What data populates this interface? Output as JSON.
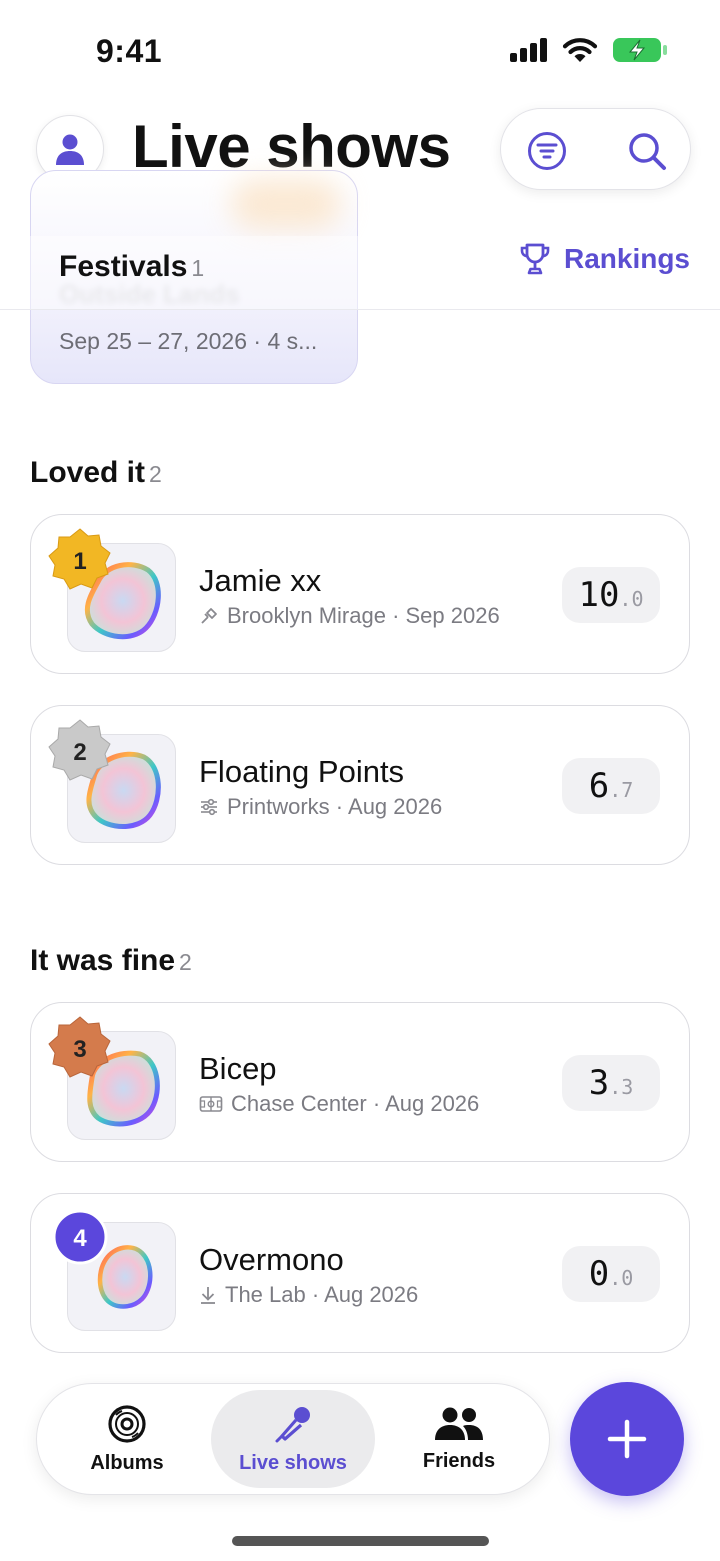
{
  "status_bar": {
    "time": "9:41"
  },
  "header": {
    "title": "Live shows"
  },
  "festivals_section": {
    "label": "Festivals",
    "count": "1",
    "card": {
      "name": "Outside Lands",
      "meta": "Sep 25 – 27, 2026 · 4 s..."
    }
  },
  "rankings": {
    "label": "Rankings"
  },
  "sections": [
    {
      "title": "Loved it",
      "count": "2",
      "items": [
        {
          "rank": "1",
          "name": "Jamie xx",
          "venue_meta": "Brooklyn Mirage · Sep 2026",
          "venue_icon": "pin-icon",
          "score_int": "10",
          "score_dec": ".0"
        },
        {
          "rank": "2",
          "name": "Floating Points",
          "venue_meta": "Printworks · Aug 2026",
          "venue_icon": "sliders-icon",
          "score_int": "6",
          "score_dec": ".7"
        }
      ]
    },
    {
      "title": "It was fine",
      "count": "2",
      "items": [
        {
          "rank": "3",
          "name": "Bicep",
          "venue_meta": "Chase Center · Aug 2026",
          "venue_icon": "stadium-icon",
          "score_int": "3",
          "score_dec": ".3"
        },
        {
          "rank": "4",
          "name": "Overmono",
          "venue_meta": "The Lab · Aug 2026",
          "venue_icon": "download-icon",
          "score_int": "0",
          "score_dec": ".0"
        }
      ]
    }
  ],
  "tab_bar": {
    "tabs": [
      {
        "label": "Albums",
        "icon": "vinyl-icon"
      },
      {
        "label": "Live shows",
        "icon": "microphone-icon",
        "active": true
      },
      {
        "label": "Friends",
        "icon": "people-icon"
      }
    ]
  },
  "colors": {
    "accent": "#5b4ed1",
    "fab": "#5b47dc",
    "gold": "#f2b724",
    "silver": "#c4c4c4",
    "bronze": "#d47b4c",
    "rank4": "#5b47dc"
  }
}
